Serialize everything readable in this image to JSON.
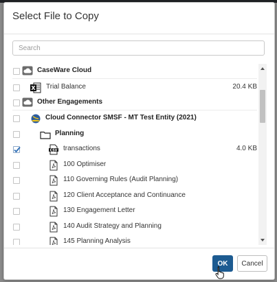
{
  "dialog": {
    "title": "Select File to Copy",
    "search_placeholder": "Search",
    "ok_label": "OK",
    "cancel_label": "Cancel"
  },
  "rows": [
    {
      "label": "CaseWare Cloud",
      "bold": true,
      "icon": "cloud-icon",
      "size": "",
      "checked": false
    },
    {
      "label": "Trial Balance",
      "bold": false,
      "icon": "excel-icon",
      "size": "20.4 KB",
      "checked": false
    },
    {
      "label": "Other Engagements",
      "bold": true,
      "icon": "cloud-icon",
      "size": "",
      "checked": false
    },
    {
      "label": "Cloud Connector SMSF - MT Test Entity (2021)",
      "bold": true,
      "icon": "entity-logo-icon",
      "size": "",
      "checked": false
    },
    {
      "label": "Planning",
      "bold": true,
      "icon": "folder-icon",
      "size": "",
      "checked": false
    },
    {
      "label": "transactions",
      "bold": false,
      "icon": "csv-file-icon",
      "size": "4.0 KB",
      "checked": true
    },
    {
      "label": "100 Optimiser",
      "bold": false,
      "icon": "document-icon",
      "size": "",
      "checked": false
    },
    {
      "label": "110 Governing Rules (Audit Planning)",
      "bold": false,
      "icon": "document-icon",
      "size": "",
      "checked": false
    },
    {
      "label": "120 Client Acceptance and Continuance",
      "bold": false,
      "icon": "document-icon",
      "size": "",
      "checked": false
    },
    {
      "label": "130 Engagement Letter",
      "bold": false,
      "icon": "document-icon",
      "size": "",
      "checked": false
    },
    {
      "label": "140 Audit Strategy and Planning",
      "bold": false,
      "icon": "document-icon",
      "size": "",
      "checked": false
    },
    {
      "label": "145 Planning Analysis",
      "bold": false,
      "icon": "document-icon",
      "size": "",
      "checked": false
    }
  ],
  "colors": {
    "accent": "#1d5b91",
    "check": "#2e6fb7"
  }
}
